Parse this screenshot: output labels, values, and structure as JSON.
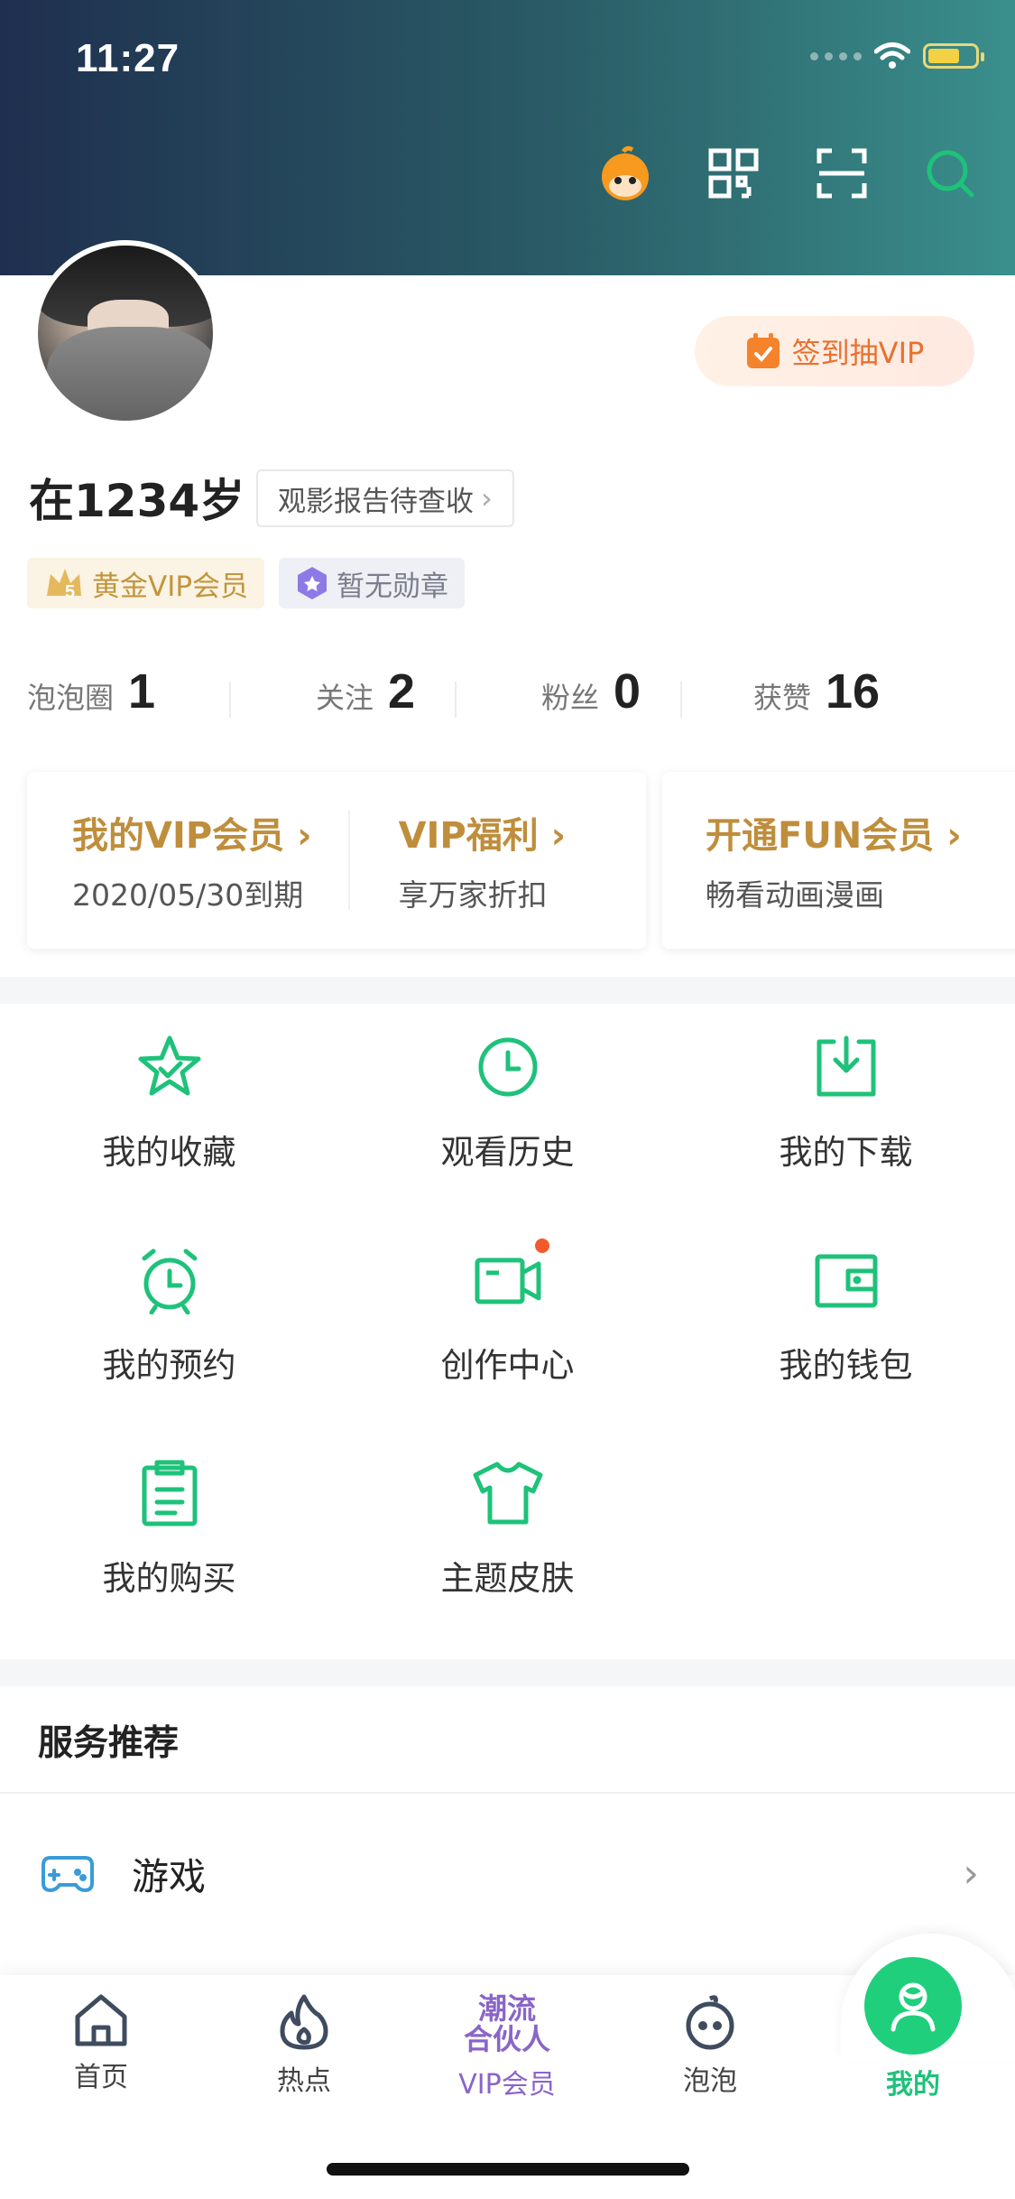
{
  "status": {
    "time": "11:27"
  },
  "header_icons": [
    "mascot-icon",
    "qr-code-icon",
    "scan-icon",
    "search-icon"
  ],
  "signin": {
    "label": "签到抽VIP"
  },
  "profile": {
    "username": "在1234岁",
    "report_label": "观影报告待查收"
  },
  "badges": {
    "vip_level": "5",
    "vip_label": "黄金VIP会员",
    "medal_label": "暂无勋章"
  },
  "stats": [
    {
      "label": "泡泡圈",
      "value": "1"
    },
    {
      "label": "关注",
      "value": "2"
    },
    {
      "label": "粉丝",
      "value": "0"
    },
    {
      "label": "获赞",
      "value": "16"
    }
  ],
  "vip_cards": {
    "my_vip_title": "我的VIP会员",
    "my_vip_sub": "2020/05/30到期",
    "welfare_title": "VIP福利",
    "welfare_sub": "享万家折扣",
    "fun_title": "开通FUN会员",
    "fun_sub": "畅看动画漫画"
  },
  "grid": [
    {
      "label": "我的收藏",
      "icon": "star-icon"
    },
    {
      "label": "观看历史",
      "icon": "clock-icon"
    },
    {
      "label": "我的下载",
      "icon": "download-icon"
    },
    {
      "label": "我的预约",
      "icon": "alarm-icon"
    },
    {
      "label": "创作中心",
      "icon": "video-camera-icon"
    },
    {
      "label": "我的钱包",
      "icon": "wallet-icon"
    },
    {
      "label": "我的购买",
      "icon": "clipboard-icon"
    },
    {
      "label": "主题皮肤",
      "icon": "tshirt-icon"
    }
  ],
  "services": {
    "title": "服务推荐",
    "game_label": "游戏"
  },
  "tabs": {
    "home": "首页",
    "hot": "热点",
    "vip": "VIP会员",
    "vip_logo_line1": "潮流",
    "vip_logo_line2": "合伙人",
    "bubble": "泡泡",
    "me": "我的"
  },
  "colors": {
    "accent_green": "#1ec27a",
    "vip_gold": "#bf8e3c",
    "vip_purple": "#8a65c8",
    "signin_orange": "#e8712e"
  }
}
